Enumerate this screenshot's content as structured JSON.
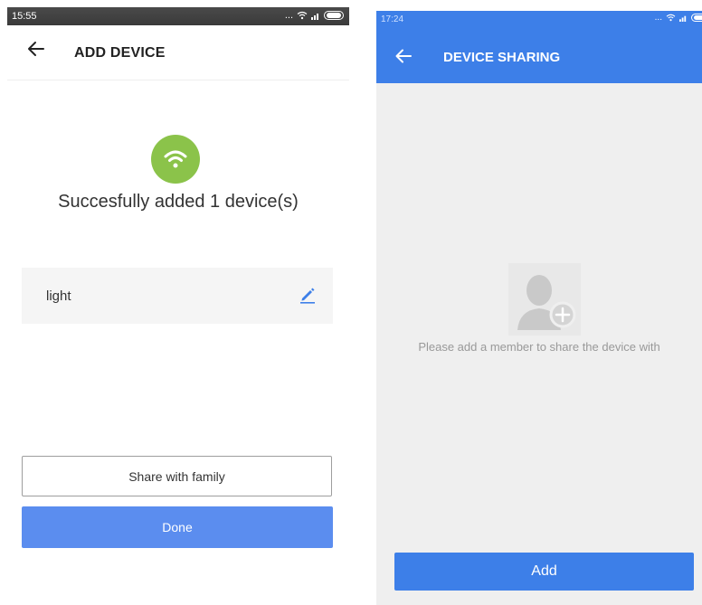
{
  "left_screen": {
    "status_bar": {
      "time": "15:55",
      "signal_text": "..."
    },
    "header": {
      "title": "ADD DEVICE"
    },
    "success_message": "Succesfully added 1 device(s)",
    "device": {
      "name": "light"
    },
    "buttons": {
      "share_label": "Share with family",
      "done_label": "Done"
    },
    "colors": {
      "wifi_badge": "#8bc34a",
      "done_button": "#5b8def"
    },
    "icons": {
      "back": "arrow-left-icon",
      "wifi": "wifi-icon",
      "edit": "pencil-icon"
    }
  },
  "right_screen": {
    "status_bar": {
      "time": "17:24",
      "signal_text": "..."
    },
    "header": {
      "title": "DEVICE SHARING"
    },
    "empty_state": {
      "message": "Please add a member to share the device with"
    },
    "buttons": {
      "add_label": "Add"
    },
    "colors": {
      "header": "#3d7fe8",
      "background": "#efefef"
    },
    "icons": {
      "back": "arrow-left-icon",
      "empty": "add-person-icon"
    }
  }
}
